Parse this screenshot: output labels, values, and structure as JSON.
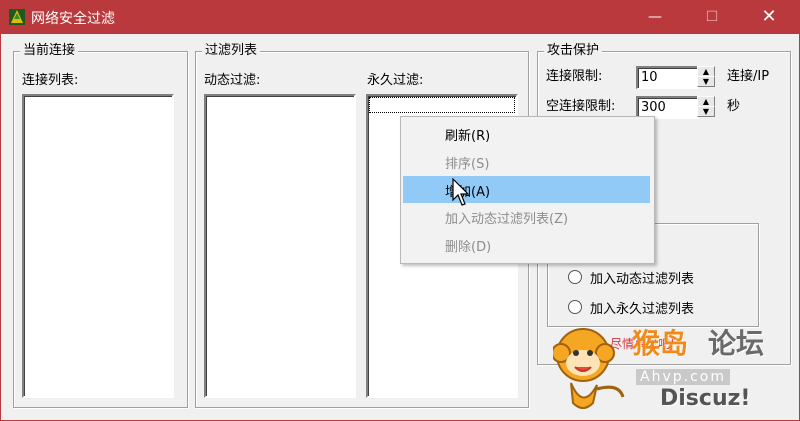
{
  "window": {
    "title": "网络安全过滤",
    "minimize_glyph": "—",
    "maximize_glyph": "☐",
    "close_glyph": "✕",
    "accent_color": "#b9393d"
  },
  "current_connections": {
    "group_title": "当前连接",
    "list_label": "连接列表:"
  },
  "filter_list": {
    "group_title": "过滤列表",
    "dynamic_label": "动态过滤:",
    "permanent_label": "永久过滤:"
  },
  "attack_protection": {
    "group_title": "攻击保护",
    "conn_limit_label": "连接限制:",
    "conn_limit_value": "10",
    "conn_limit_unit": "连接/IP",
    "idle_limit_label": "空连接限制:",
    "idle_limit_value": "300",
    "idle_limit_unit": "秒",
    "radio_dynamic": "加入动态过滤列表",
    "radio_permanent": "加入永久过滤列表"
  },
  "context_menu": {
    "items": [
      {
        "label": "刷新(R)",
        "enabled": true
      },
      {
        "label": "排序(S)",
        "enabled": false
      },
      {
        "label": "增加(A)",
        "enabled": true,
        "highlighted": true
      },
      {
        "label": "加入动态过滤列表(Z)",
        "enabled": false
      },
      {
        "label": "删除(D)",
        "enabled": false
      }
    ]
  },
  "watermark": {
    "red_text": "尽情享受吧!",
    "brand_orange": "猴岛",
    "brand_gray": "论坛",
    "site": "Ahvp.com",
    "discuz": "Discuz!"
  }
}
